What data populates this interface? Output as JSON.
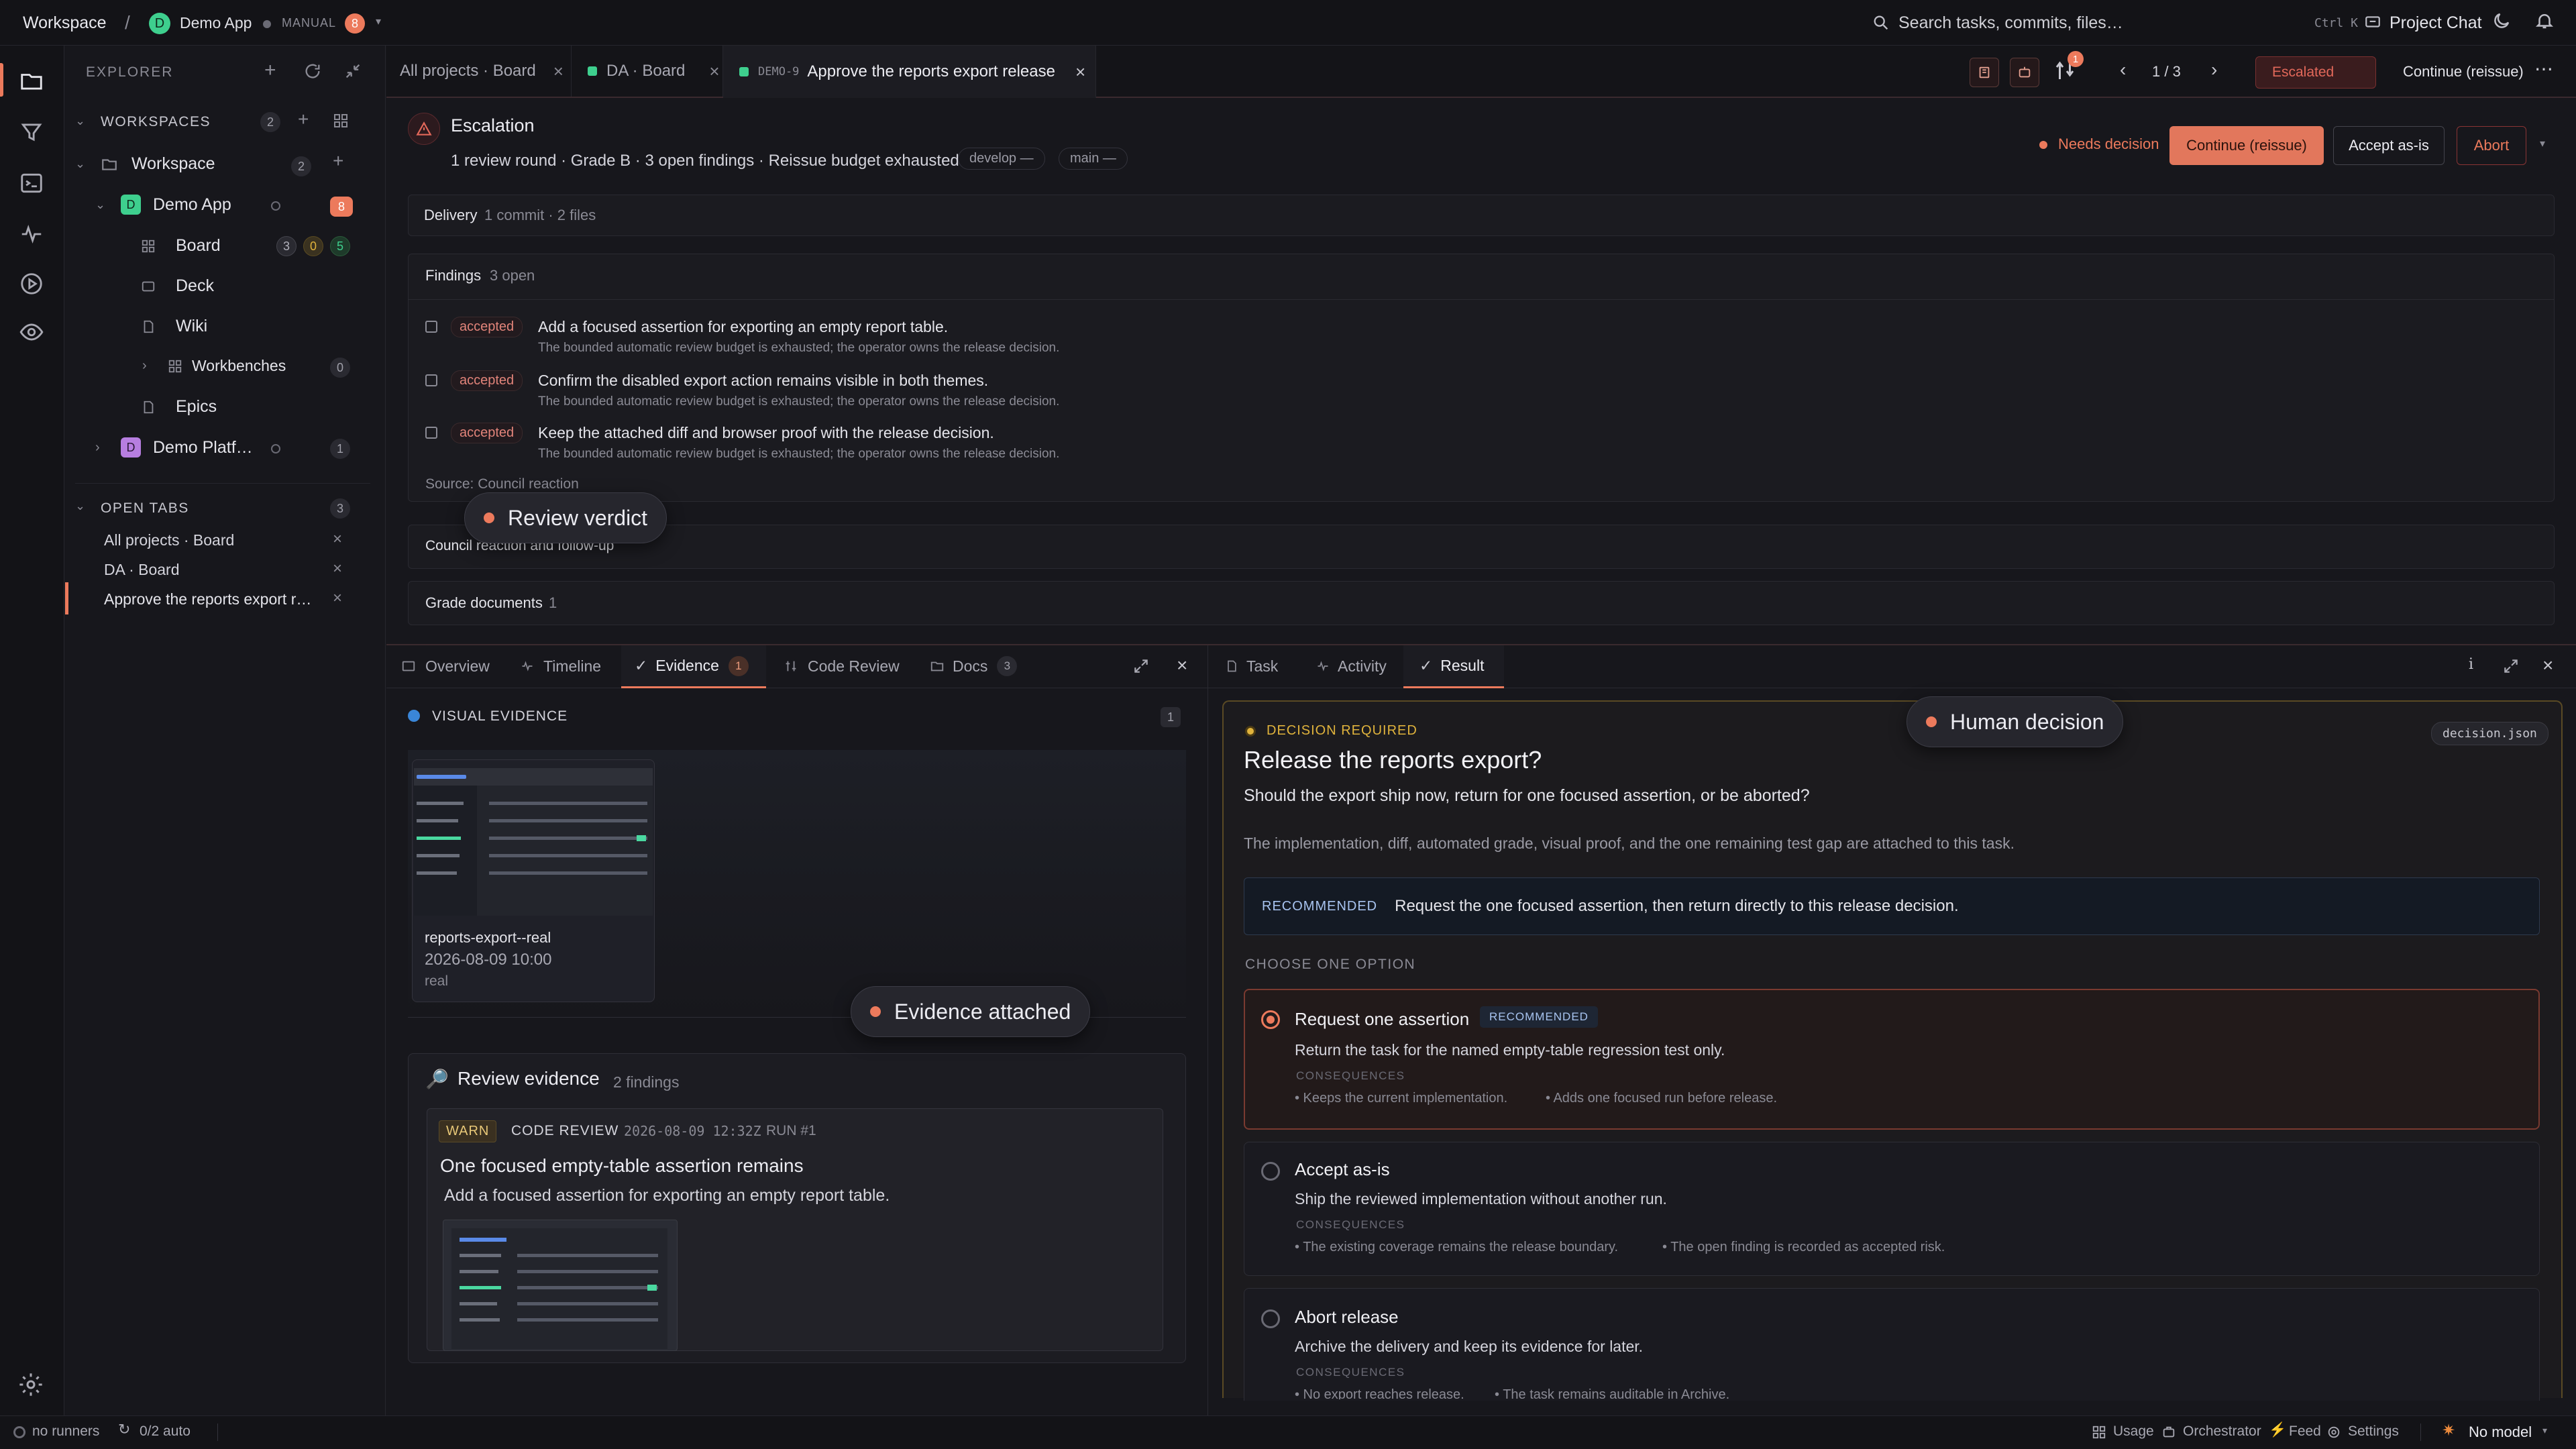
{
  "topbar": {
    "workspace": "Workspace",
    "slash": "/",
    "app_initial": "D",
    "app_name": "Demo App",
    "mode": "MANUAL",
    "mode_count": "8",
    "search_placeholder": "Search tasks, commits, files…",
    "shortcut": "Ctrl K",
    "project_chat": "Project Chat"
  },
  "explorer": {
    "title": "EXPLORER",
    "workspaces_label": "WORKSPACES",
    "workspaces_count": "2",
    "workspace_name": "Workspace",
    "workspace_count": "2",
    "demo_app": {
      "initial": "D",
      "name": "Demo App",
      "count": "8"
    },
    "children": [
      {
        "name": "Board",
        "c1": "3",
        "c2": "0",
        "c3": "5"
      },
      {
        "name": "Deck"
      },
      {
        "name": "Wiki"
      },
      {
        "name": "Workbenches",
        "count": "0"
      },
      {
        "name": "Epics"
      }
    ],
    "demo_platform": {
      "initial": "D",
      "name": "Demo Platf…",
      "count": "1"
    },
    "open_tabs_label": "OPEN TABS",
    "open_tabs_count": "3",
    "open_tabs": [
      "All projects · Board",
      "DA · Board",
      "Approve the reports export r…"
    ]
  },
  "tabs": [
    {
      "label": "All projects · Board"
    },
    {
      "label": "DA · Board",
      "dot": "#3ecf8e"
    },
    {
      "prefix": "DEMO-9",
      "label": "Approve the reports export release",
      "dot": "#3ecf8e"
    }
  ],
  "toolbar": {
    "badge": "1",
    "pager": "1 / 3",
    "status": "Escalated",
    "continue": "Continue (reissue)"
  },
  "escalation": {
    "title": "Escalation",
    "meta": "1 review round · Grade B · 3 open findings · Reissue budget exhausted",
    "branch1": "develop —",
    "branch2": "main —",
    "needs_decision": "Needs decision",
    "btn_continue": "Continue (reissue)",
    "btn_accept": "Accept as-is",
    "btn_abort": "Abort"
  },
  "delivery": {
    "label": "Delivery",
    "meta": "1 commit · 2 files"
  },
  "findings": {
    "label": "Findings",
    "meta": "3 open",
    "items": [
      {
        "tag": "accepted",
        "title": "Add a focused assertion for exporting an empty report table.",
        "sub": "The bounded automatic review budget is exhausted; the operator owns the release decision."
      },
      {
        "tag": "accepted",
        "title": "Confirm the disabled export action remains visible in both themes.",
        "sub": "The bounded automatic review budget is exhausted; the operator owns the release decision."
      },
      {
        "tag": "accepted",
        "title": "Keep the attached diff and browser proof with the release decision.",
        "sub": "The bounded automatic review budget is exhausted; the operator owns the release decision."
      }
    ],
    "source": "Source: Council reaction"
  },
  "council": {
    "label": "Council reaction and follow-up"
  },
  "grade_docs": {
    "label": "Grade documents",
    "count": "1"
  },
  "left_panel": {
    "tabs": [
      {
        "label": "Overview"
      },
      {
        "label": "Timeline"
      },
      {
        "label": "Evidence",
        "count": "1"
      },
      {
        "label": "Code Review"
      },
      {
        "label": "Docs",
        "count": "3"
      }
    ],
    "visual_evidence": "VISUAL EVIDENCE",
    "visual_count": "1",
    "thumb": {
      "name": "reports-export--real",
      "date": "2026-08-09 10:00",
      "kind": "real"
    },
    "review_evidence": "Review evidence",
    "review_findings": "2 findings",
    "warn": "WARN",
    "code_review": "CODE REVIEW",
    "timestamp": "2026-08-09 12:32Z",
    "run": "RUN #1",
    "card_title": "One focused empty-table assertion remains",
    "card_sub": "Add a focused assertion for exporting an empty report table."
  },
  "right_panel": {
    "tabs": [
      {
        "label": "Task"
      },
      {
        "label": "Activity"
      },
      {
        "label": "Result"
      }
    ],
    "decision_required": "DECISION REQUIRED",
    "file": "decision.json",
    "title": "Release the reports export?",
    "question": "Should the export ship now, return for one focused assertion, or be aborted?",
    "context": "The implementation, diff, automated grade, visual proof, and the one remaining test gap are attached to this task.",
    "recommended_label": "RECOMMENDED",
    "recommended_text": "Request the one focused assertion, then return directly to this release decision.",
    "choose": "CHOOSE ONE OPTION",
    "options": [
      {
        "title": "Request one assertion",
        "badge": "RECOMMENDED",
        "desc": "Return the task for the named empty-table regression test only.",
        "cons_label": "CONSEQUENCES",
        "c1": "• Keeps the current implementation.",
        "c2": "• Adds one focused run before release."
      },
      {
        "title": "Accept as-is",
        "desc": "Ship the reviewed implementation without another run.",
        "cons_label": "CONSEQUENCES",
        "c1": "• The existing coverage remains the release boundary.",
        "c2": "• The open finding is recorded as accepted risk."
      },
      {
        "title": "Abort release",
        "desc": "Archive the delivery and keep its evidence for later.",
        "cons_label": "CONSEQUENCES",
        "c1": "• No export reaches release.",
        "c2": "• The task remains auditable in Archive."
      }
    ]
  },
  "callouts": {
    "review_verdict": "Review verdict",
    "evidence_attached": "Evidence attached",
    "human_decision": "Human decision"
  },
  "statusbar": {
    "runners": "no runners",
    "auto": "0/2 auto",
    "usage": "Usage",
    "orchestrator": "Orchestrator",
    "feed": "Feed",
    "settings": "Settings",
    "model": "No model"
  },
  "colors": {
    "accent": "#ec7a5c",
    "green": "#3ecf8e",
    "gold": "#e0b33c",
    "bg": "#17171c"
  }
}
